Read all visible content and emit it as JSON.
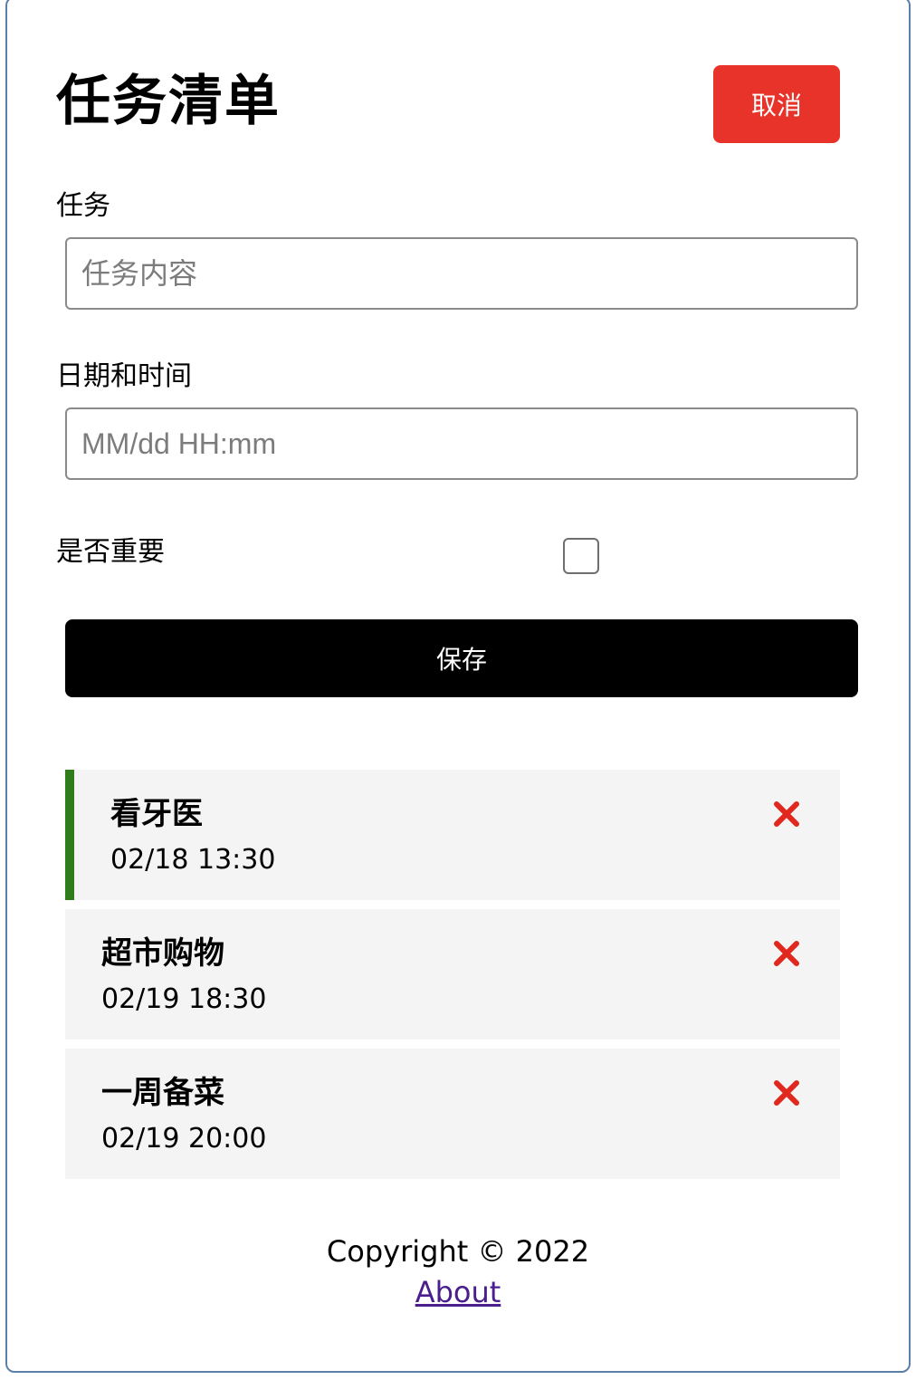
{
  "header": {
    "title": "任务清单",
    "cancel_label": "取消"
  },
  "form": {
    "task_label": "任务",
    "task_placeholder": "任务内容",
    "task_value": "",
    "datetime_label": "日期和时间",
    "datetime_placeholder": "MM/dd HH:mm",
    "datetime_value": "",
    "important_label": "是否重要",
    "important_checked": false,
    "save_label": "保存"
  },
  "tasks": [
    {
      "text": "看牙医",
      "time": "02/18 13:30",
      "important": true
    },
    {
      "text": "超市购物",
      "time": "02/19 18:30",
      "important": false
    },
    {
      "text": "一周备菜",
      "time": "02/19 20:00",
      "important": false
    }
  ],
  "footer": {
    "copyright": "Copyright © 2022",
    "about_label": "About"
  },
  "colors": {
    "cancel": "#e8332a",
    "save": "#000000",
    "important_bar": "#2e7d1a",
    "delete": "#e0281f",
    "link": "#4a1e8c"
  },
  "icons": {
    "delete": "close-icon"
  }
}
